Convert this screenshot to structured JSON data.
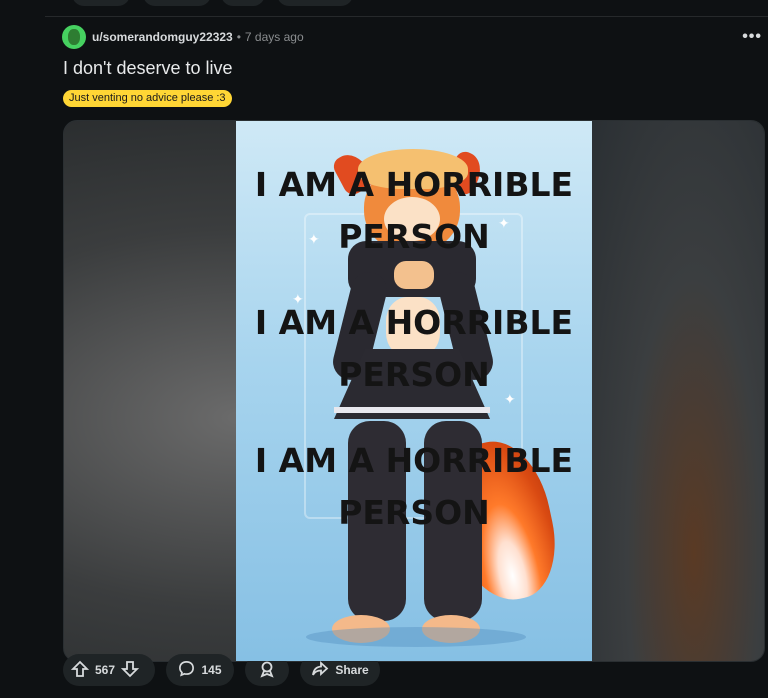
{
  "post": {
    "username": "u/somerandomguy22323",
    "separator": "•",
    "time": "7 days ago",
    "more": "•••",
    "title": "I don't deserve to live",
    "flair": "Just venting no advice please :3"
  },
  "media": {
    "overlay_lines": [
      "I AM A HORRIBLE",
      "PERSON",
      "I AM A HORRIBLE",
      "PERSON",
      "I AM A HORRIBLE",
      "PERSON"
    ]
  },
  "actions": {
    "upvotes": "567",
    "comments": "145",
    "share": "Share"
  },
  "colors": {
    "background": "#0e1113",
    "flair": "#ffd635",
    "pill": "#1f2426"
  }
}
